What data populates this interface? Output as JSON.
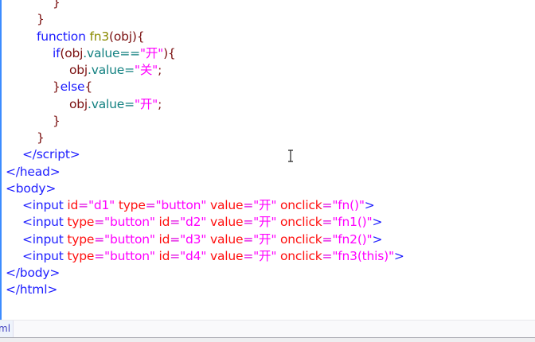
{
  "editor": {
    "lines": [
      {
        "indent": 3,
        "tokens": [
          {
            "t": "punct",
            "v": "}"
          }
        ]
      },
      {
        "indent": 2,
        "tokens": [
          {
            "t": "punct",
            "v": "}"
          }
        ]
      },
      {
        "indent": 2,
        "tokens": [
          {
            "t": "kw",
            "v": "function "
          },
          {
            "t": "fn",
            "v": "fn3"
          },
          {
            "t": "var",
            "v": "(obj){"
          }
        ]
      },
      {
        "indent": 3,
        "tokens": [
          {
            "t": "kw",
            "v": "if"
          },
          {
            "t": "var",
            "v": "(obj"
          },
          {
            "t": "prop",
            "v": ".value=="
          },
          {
            "t": "str",
            "v": "\"开\""
          },
          {
            "t": "var",
            "v": "){"
          }
        ]
      },
      {
        "indent": 4,
        "tokens": [
          {
            "t": "var",
            "v": "obj"
          },
          {
            "t": "prop",
            "v": ".value="
          },
          {
            "t": "str",
            "v": "\"关\""
          },
          {
            "t": "var",
            "v": ";"
          }
        ]
      },
      {
        "indent": 3,
        "tokens": [
          {
            "t": "punct",
            "v": "}"
          },
          {
            "t": "kw",
            "v": "else"
          },
          {
            "t": "punct",
            "v": "{"
          }
        ]
      },
      {
        "indent": 4,
        "tokens": [
          {
            "t": "var",
            "v": "obj"
          },
          {
            "t": "prop",
            "v": ".value="
          },
          {
            "t": "str",
            "v": "\"开\""
          },
          {
            "t": "var",
            "v": ";"
          }
        ]
      },
      {
        "indent": 3,
        "tokens": [
          {
            "t": "punct",
            "v": "}"
          }
        ]
      },
      {
        "indent": 2,
        "tokens": [
          {
            "t": "punct",
            "v": "}"
          }
        ]
      },
      {
        "indent": 1,
        "tokens": [
          {
            "t": "tag",
            "v": "</script>"
          }
        ]
      },
      {
        "indent": 0,
        "tokens": [
          {
            "t": "tag",
            "v": "</head>"
          }
        ]
      },
      {
        "indent": 0,
        "tokens": [
          {
            "t": "tag",
            "v": "<body>"
          }
        ]
      },
      {
        "indent": 1,
        "tokens": [
          {
            "t": "tag",
            "v": "<input "
          },
          {
            "t": "attr",
            "v": "id"
          },
          {
            "t": "eq",
            "v": "="
          },
          {
            "t": "str",
            "v": "\"d1\" "
          },
          {
            "t": "attr",
            "v": "type"
          },
          {
            "t": "eq",
            "v": "="
          },
          {
            "t": "str",
            "v": "\"button\" "
          },
          {
            "t": "attr",
            "v": "value"
          },
          {
            "t": "eq",
            "v": "="
          },
          {
            "t": "str",
            "v": "\"开\" "
          },
          {
            "t": "attr",
            "v": "onclick"
          },
          {
            "t": "eq",
            "v": "="
          },
          {
            "t": "str",
            "v": "\"fn()\""
          },
          {
            "t": "tag",
            "v": ">"
          }
        ]
      },
      {
        "indent": 1,
        "tokens": [
          {
            "t": "tag",
            "v": "<input "
          },
          {
            "t": "attr",
            "v": "type"
          },
          {
            "t": "eq",
            "v": "="
          },
          {
            "t": "str",
            "v": "\"button\" "
          },
          {
            "t": "attr",
            "v": "id"
          },
          {
            "t": "eq",
            "v": "="
          },
          {
            "t": "str",
            "v": "\"d2\" "
          },
          {
            "t": "attr",
            "v": "value"
          },
          {
            "t": "eq",
            "v": "="
          },
          {
            "t": "str",
            "v": "\"开\" "
          },
          {
            "t": "attr",
            "v": "onclick"
          },
          {
            "t": "eq",
            "v": "="
          },
          {
            "t": "str",
            "v": "\"fn1()\""
          },
          {
            "t": "tag",
            "v": ">"
          }
        ]
      },
      {
        "indent": 1,
        "tokens": [
          {
            "t": "tag",
            "v": "<input "
          },
          {
            "t": "attr",
            "v": "type"
          },
          {
            "t": "eq",
            "v": "="
          },
          {
            "t": "str",
            "v": "\"button\" "
          },
          {
            "t": "attr",
            "v": "id"
          },
          {
            "t": "eq",
            "v": "="
          },
          {
            "t": "str",
            "v": "\"d3\" "
          },
          {
            "t": "attr",
            "v": "value"
          },
          {
            "t": "eq",
            "v": "="
          },
          {
            "t": "str",
            "v": "\"开\" "
          },
          {
            "t": "attr",
            "v": "onclick"
          },
          {
            "t": "eq",
            "v": "="
          },
          {
            "t": "str",
            "v": "\"fn2()\""
          },
          {
            "t": "tag",
            "v": ">"
          }
        ]
      },
      {
        "indent": 1,
        "tokens": [
          {
            "t": "tag",
            "v": "<input "
          },
          {
            "t": "attr",
            "v": "type"
          },
          {
            "t": "eq",
            "v": "="
          },
          {
            "t": "str",
            "v": "\"button\" "
          },
          {
            "t": "attr",
            "v": "id"
          },
          {
            "t": "eq",
            "v": "="
          },
          {
            "t": "str",
            "v": "\"d4\" "
          },
          {
            "t": "attr",
            "v": "value"
          },
          {
            "t": "eq",
            "v": "="
          },
          {
            "t": "str",
            "v": "\"开\" "
          },
          {
            "t": "attr",
            "v": "onclick"
          },
          {
            "t": "eq",
            "v": "="
          },
          {
            "t": "str",
            "v": "\"fn3(this)\""
          },
          {
            "t": "tag",
            "v": ">"
          }
        ]
      },
      {
        "indent": 0,
        "tokens": [
          {
            "t": "tag",
            "v": "</body>"
          }
        ]
      },
      {
        "indent": 0,
        "tokens": [
          {
            "t": "tag",
            "v": "</html>"
          }
        ]
      }
    ]
  },
  "tabbar": {
    "active_tab": "ml"
  }
}
